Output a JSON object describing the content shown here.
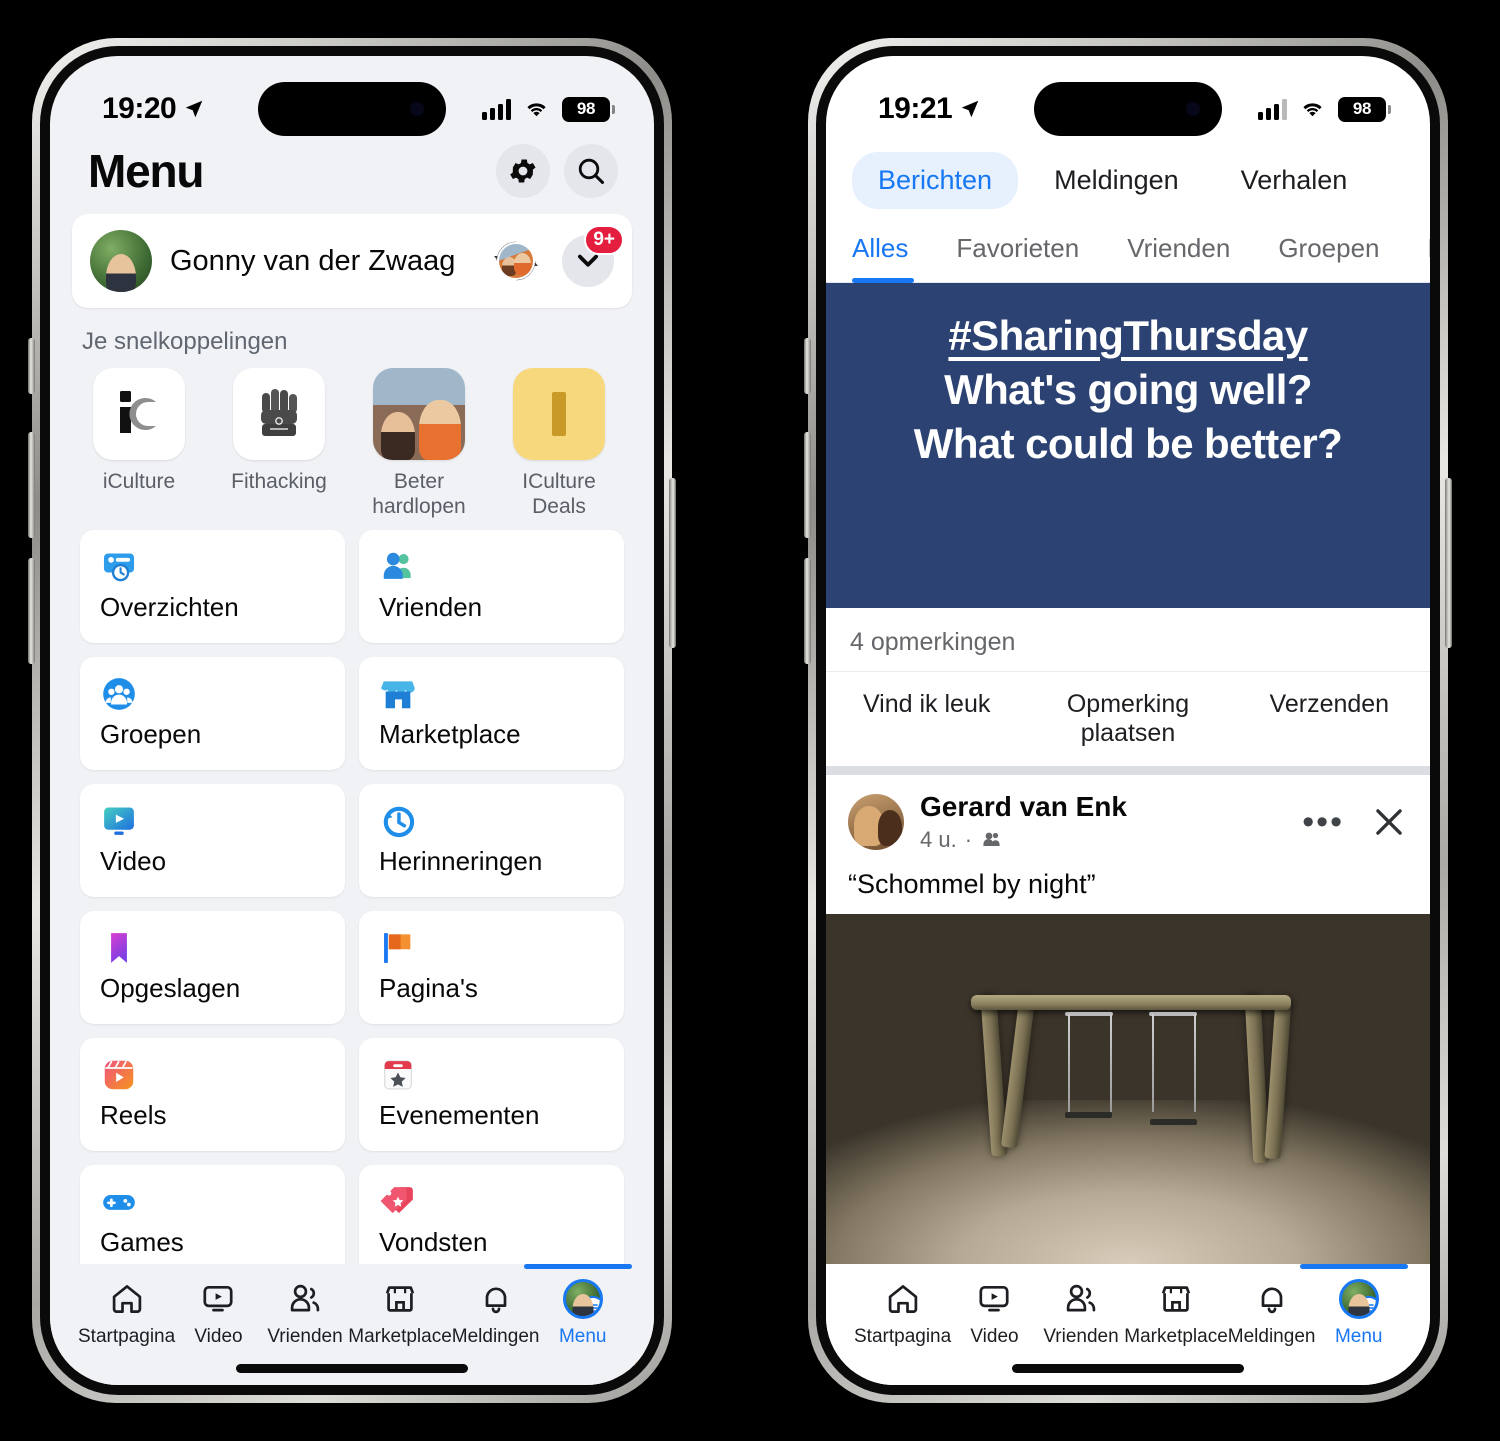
{
  "left_phone": {
    "status_bar": {
      "time": "19:20",
      "battery": "98",
      "location_icon": "location-arrow-icon",
      "cellular_icon": "cellular-bars-icon",
      "wifi_icon": "wifi-icon"
    },
    "header": {
      "title": "Menu",
      "settings_icon": "gear-icon",
      "search_icon": "search-icon"
    },
    "profile": {
      "name": "Gonny van der Zwaag",
      "avatar": "user-avatar",
      "switch_account_icon": "switch-account-icon",
      "expand_icon": "chevron-down-icon",
      "badge": "9+"
    },
    "shortcuts_label": "Je snelkoppelingen",
    "shortcuts": [
      {
        "label": "iCulture",
        "icon": "iculture-logo-icon",
        "badge_icon": "page-flag-icon"
      },
      {
        "label": "Fithacking",
        "icon": "raised-fist-icon",
        "badge_icon": "page-flag-icon"
      },
      {
        "label": "Beter hardlopen",
        "icon": "couple-photo-icon",
        "badge_icon": "page-flag-icon"
      },
      {
        "label": "ICulture Deals",
        "icon": "deals-logo-icon",
        "badge_icon": "page-flag-icon"
      }
    ],
    "menu_tiles": [
      {
        "label": "Overzichten",
        "icon": "feeds-icon"
      },
      {
        "label": "Vrienden",
        "icon": "friends-icon"
      },
      {
        "label": "Groepen",
        "icon": "groups-icon"
      },
      {
        "label": "Marketplace",
        "icon": "marketplace-icon"
      },
      {
        "label": "Video",
        "icon": "video-icon"
      },
      {
        "label": "Herinneringen",
        "icon": "memories-clock-icon"
      },
      {
        "label": "Opgeslagen",
        "icon": "saved-bookmark-icon"
      },
      {
        "label": "Pagina's",
        "icon": "pages-flag-icon"
      },
      {
        "label": "Reels",
        "icon": "reels-icon"
      },
      {
        "label": "Evenementen",
        "icon": "events-calendar-icon"
      },
      {
        "label": "Games",
        "icon": "games-controller-icon"
      },
      {
        "label": "Vondsten",
        "icon": "deals-tag-icon"
      }
    ],
    "tabbar": [
      {
        "label": "Startpagina",
        "icon": "home-icon",
        "active": false
      },
      {
        "label": "Video",
        "icon": "video-icon",
        "active": false
      },
      {
        "label": "Vrienden",
        "icon": "friends-icon",
        "active": false
      },
      {
        "label": "Marketplace",
        "icon": "marketplace-icon",
        "active": false
      },
      {
        "label": "Meldingen",
        "icon": "bell-icon",
        "active": false
      },
      {
        "label": "Menu",
        "icon": "profile-menu-avatar-icon",
        "active": true
      }
    ]
  },
  "right_phone": {
    "status_bar": {
      "time": "19:21",
      "battery": "98"
    },
    "pill_tabs": [
      {
        "label": "Berichten",
        "active": true
      },
      {
        "label": "Meldingen",
        "active": false
      },
      {
        "label": "Verhalen",
        "active": false
      }
    ],
    "filter_chips": [
      {
        "label": "Alles",
        "active": true
      },
      {
        "label": "Favorieten",
        "active": false
      },
      {
        "label": "Vrienden",
        "active": false
      },
      {
        "label": "Groepen",
        "active": false
      },
      {
        "label": "Pagina",
        "active": false
      }
    ],
    "banner": {
      "line1": "#SharingThursday",
      "line2": "What's going well?",
      "line3": "What could be better?",
      "bg_color": "#2b4272"
    },
    "comment_count": "4 opmerkingen",
    "post_actions": [
      {
        "label": "Vind ik leuk"
      },
      {
        "label": "Opmerking plaatsen"
      },
      {
        "label": "Verzenden"
      }
    ],
    "post": {
      "author": "Gerard van Enk",
      "time": "4 u.",
      "audience_icon": "friends-audience-icon",
      "more_icon": "ellipsis-icon",
      "close_icon": "close-x-icon",
      "text": "“Schommel by night”",
      "photo_alt": "night-photo-swing-set"
    },
    "tabbar": [
      {
        "label": "Startpagina",
        "icon": "home-icon",
        "active": false
      },
      {
        "label": "Video",
        "icon": "video-icon",
        "active": false
      },
      {
        "label": "Vrienden",
        "icon": "friends-icon",
        "active": false
      },
      {
        "label": "Marketplace",
        "icon": "marketplace-icon",
        "active": false
      },
      {
        "label": "Meldingen",
        "icon": "bell-icon",
        "active": false
      },
      {
        "label": "Menu",
        "icon": "profile-menu-avatar-icon",
        "active": true
      }
    ]
  },
  "theme": {
    "accent": "#1877f2",
    "badge_red": "#e41e3f",
    "page_bg": "#f0f2f5"
  }
}
